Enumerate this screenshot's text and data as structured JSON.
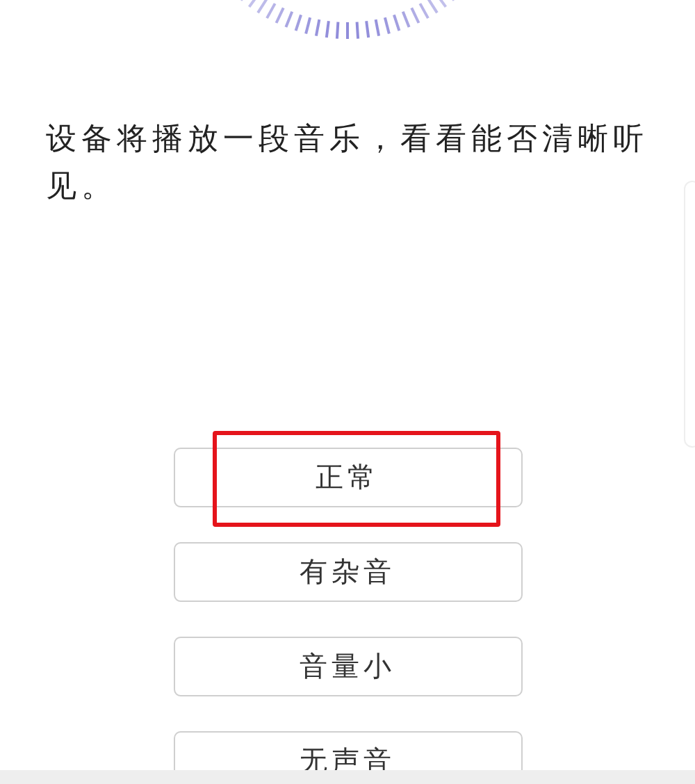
{
  "prompt": "设备将播放一段音乐，看看能否清晰听见。",
  "options": [
    {
      "label": "正常",
      "highlighted": true
    },
    {
      "label": "有杂音",
      "highlighted": false
    },
    {
      "label": "音量小",
      "highlighted": false
    },
    {
      "label": "无声音",
      "highlighted": false
    }
  ]
}
